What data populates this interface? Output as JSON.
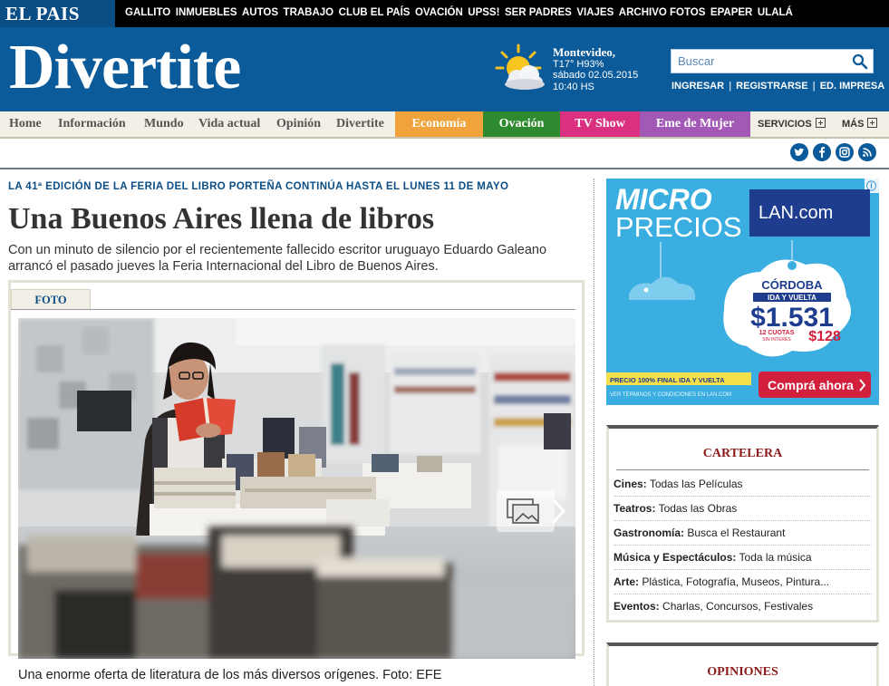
{
  "topbar": {
    "logo": "EL PAIS",
    "links": [
      "GALLITO",
      "INMUEBLES",
      "AUTOS",
      "TRABAJO",
      "CLUB EL PAÍS",
      "OVACIÓN",
      "UPSS!",
      "SER PADRES",
      "VIAJES",
      "ARCHIVO FOTOS",
      "EPAPER",
      "ULALÁ"
    ]
  },
  "header": {
    "brand": "Divertite",
    "weather": {
      "icon": "partly-cloudy-icon",
      "city": "Montevideo,",
      "conditions": "T17° H93%",
      "date": "sábado 02.05.2015",
      "time": "10:40 HS"
    },
    "search": {
      "placeholder": "Buscar"
    },
    "user_links": {
      "login": "INGRESAR",
      "register": "REGISTRARSE",
      "print": "ED. IMPRESA"
    }
  },
  "nav": {
    "items": [
      "Home",
      "Información",
      "Mundo",
      "Vida actual",
      "Opinión",
      "Divertite"
    ],
    "colored": [
      {
        "label": "Economía",
        "color": "#f0a33a"
      },
      {
        "label": "Ovación",
        "color": "#2f8a2f"
      },
      {
        "label": "TV Show",
        "color": "#d9307f"
      },
      {
        "label": "Eme de Mujer",
        "color": "#a259b5"
      }
    ],
    "services": "SERVICIOS",
    "more": "MÁS"
  },
  "social": [
    "twitter-icon",
    "facebook-icon",
    "instagram-icon",
    "rss-icon"
  ],
  "article": {
    "kicker": "LA 41ª EDICIÓN DE LA FERIA DEL LIBRO PORTEÑA CONTINÚA HASTA EL LUNES 11 DE MAYO",
    "headline": "Una Buenos Aires llena de libros",
    "lead": "Con un minuto de silencio por el recientemente fallecido escritor uruguayo Eduardo Galeano arrancó el pasado jueves la Feria Internacional del Libro de Buenos Aires.",
    "media_tab": "FOTO",
    "caption": "Una enorme oferta de literatura de los más diversos orígenes. Foto: EFE"
  },
  "ad": {
    "title_line1": "MICRO",
    "title_line2": "PRECIOS",
    "brand": "LAN.com",
    "destination": "CÓRDOBA",
    "trip": "IDA Y VUELTA",
    "price": "$1.531",
    "installments": "12 CUOTAS",
    "installments_sub": "SIN INTERÉS",
    "installment_price": "$128",
    "final_price_note": "PRECIO 100% FINAL IDA Y VUELTA",
    "terms": "VER TÉRMINOS Y CONDICIONES EN LAN.COM",
    "cta": "Comprá ahora"
  },
  "cartelera": {
    "title": "CARTELERA",
    "items": [
      {
        "label": "Cines:",
        "value": "Todas las Películas"
      },
      {
        "label": "Teatros:",
        "value": "Todas las Obras"
      },
      {
        "label": "Gastronomía:",
        "value": "Busca el Restaurant"
      },
      {
        "label": "Música y Espectáculos:",
        "value": "Toda la música"
      },
      {
        "label": "Arte:",
        "value": "Plástica, Fotografía, Museos, Pintura..."
      },
      {
        "label": "Eventos:",
        "value": "Charlas, Concursos, Festivales"
      }
    ]
  },
  "opiniones": {
    "title": "OPINIONES"
  }
}
